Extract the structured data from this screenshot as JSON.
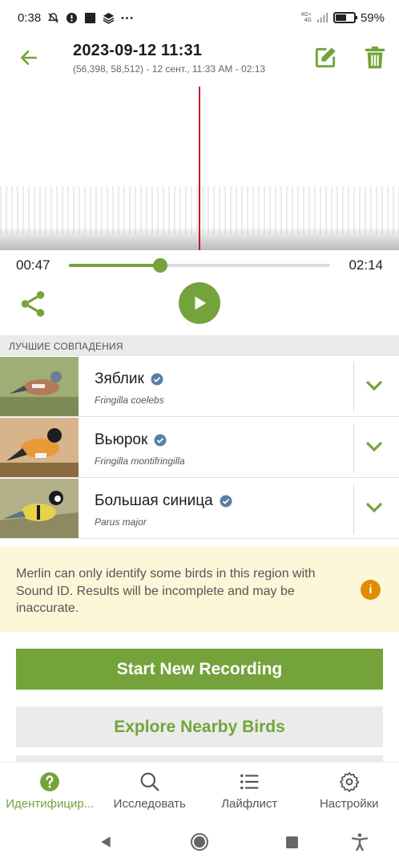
{
  "status_bar": {
    "time": "0:38",
    "network": "4G+",
    "network_sub": "4G",
    "battery_percent": 59,
    "battery_label": "59%",
    "icons": [
      "mute-bell-icon",
      "alert-icon",
      "square-icon",
      "stack-icon",
      "more-dots-icon",
      "signal-icon",
      "battery-icon"
    ]
  },
  "header": {
    "title": "2023-09-12 11:31",
    "subtitle": "(56,398, 58,512) - 12 сент., 11:33 AM - 02:13"
  },
  "player": {
    "current_time": "00:47",
    "total_time": "02:14",
    "progress": 0.35
  },
  "matches": {
    "section_title": "ЛУЧШИЕ СОВПАДЕНИЯ",
    "items": [
      {
        "name": "Зяблик",
        "scientific": "Fringilla coelebs"
      },
      {
        "name": "Вьюрок",
        "scientific": "Fringilla montifringilla"
      },
      {
        "name": "Большая синица",
        "scientific": "Parus major"
      }
    ]
  },
  "notice": {
    "text": "Merlin can only identify some birds in this region with Sound ID. Results will be incomplete and may be inaccurate.",
    "icon": "i"
  },
  "actions": {
    "primary": "Start New Recording",
    "secondary": "Explore Nearby Birds"
  },
  "nav": {
    "items": [
      {
        "label": "Идентифицир...",
        "icon": "question-icon",
        "active": true
      },
      {
        "label": "Исследовать",
        "icon": "search-icon",
        "active": false
      },
      {
        "label": "Лайфлист",
        "icon": "list-icon",
        "active": false
      },
      {
        "label": "Настройки",
        "icon": "gear-icon",
        "active": false
      }
    ]
  },
  "colors": {
    "accent": "#74a33c",
    "playhead": "#c8102e",
    "notice_bg": "#fbf7d8",
    "info": "#e08c00"
  }
}
